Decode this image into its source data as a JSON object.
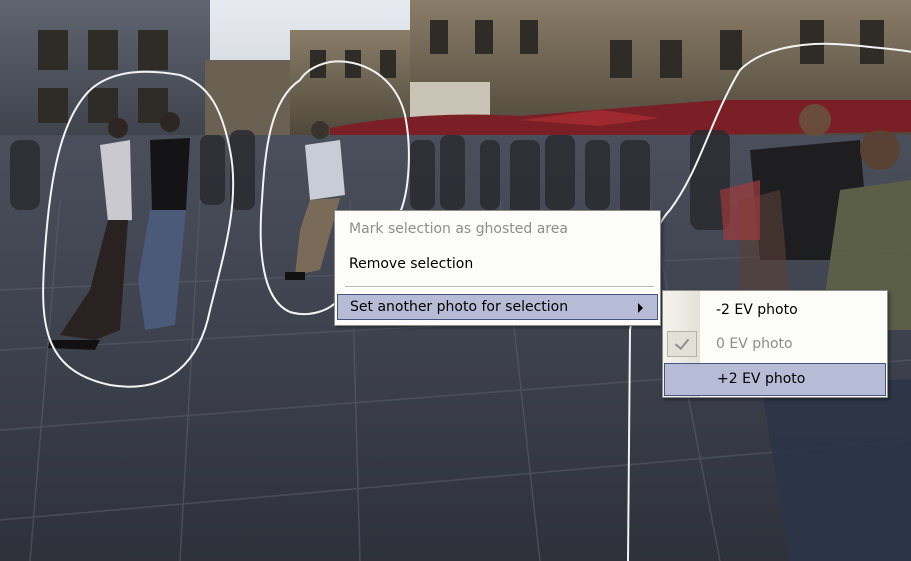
{
  "context_menu": {
    "items": [
      {
        "label": "Mark selection as ghosted area",
        "state": "disabled"
      },
      {
        "label": "Remove selection",
        "state": "enabled"
      },
      {
        "label": "Set another photo for selection",
        "state": "highlighted",
        "icon": "submenu-arrow-icon"
      }
    ]
  },
  "submenu": {
    "items": [
      {
        "label": "-2 EV photo",
        "checked": false,
        "state": "enabled"
      },
      {
        "label": "0 EV photo",
        "checked": true,
        "state": "disabled",
        "icon": "checkmark-icon"
      },
      {
        "label": "+2 EV photo",
        "checked": false,
        "state": "highlighted"
      }
    ]
  },
  "colors": {
    "menu_background": "#fcfcf8",
    "highlight_background": "#b6bcd6",
    "highlight_border": "#4a5382",
    "disabled_text": "#8e8e8e",
    "selection_outline": "#f2f2f2"
  }
}
